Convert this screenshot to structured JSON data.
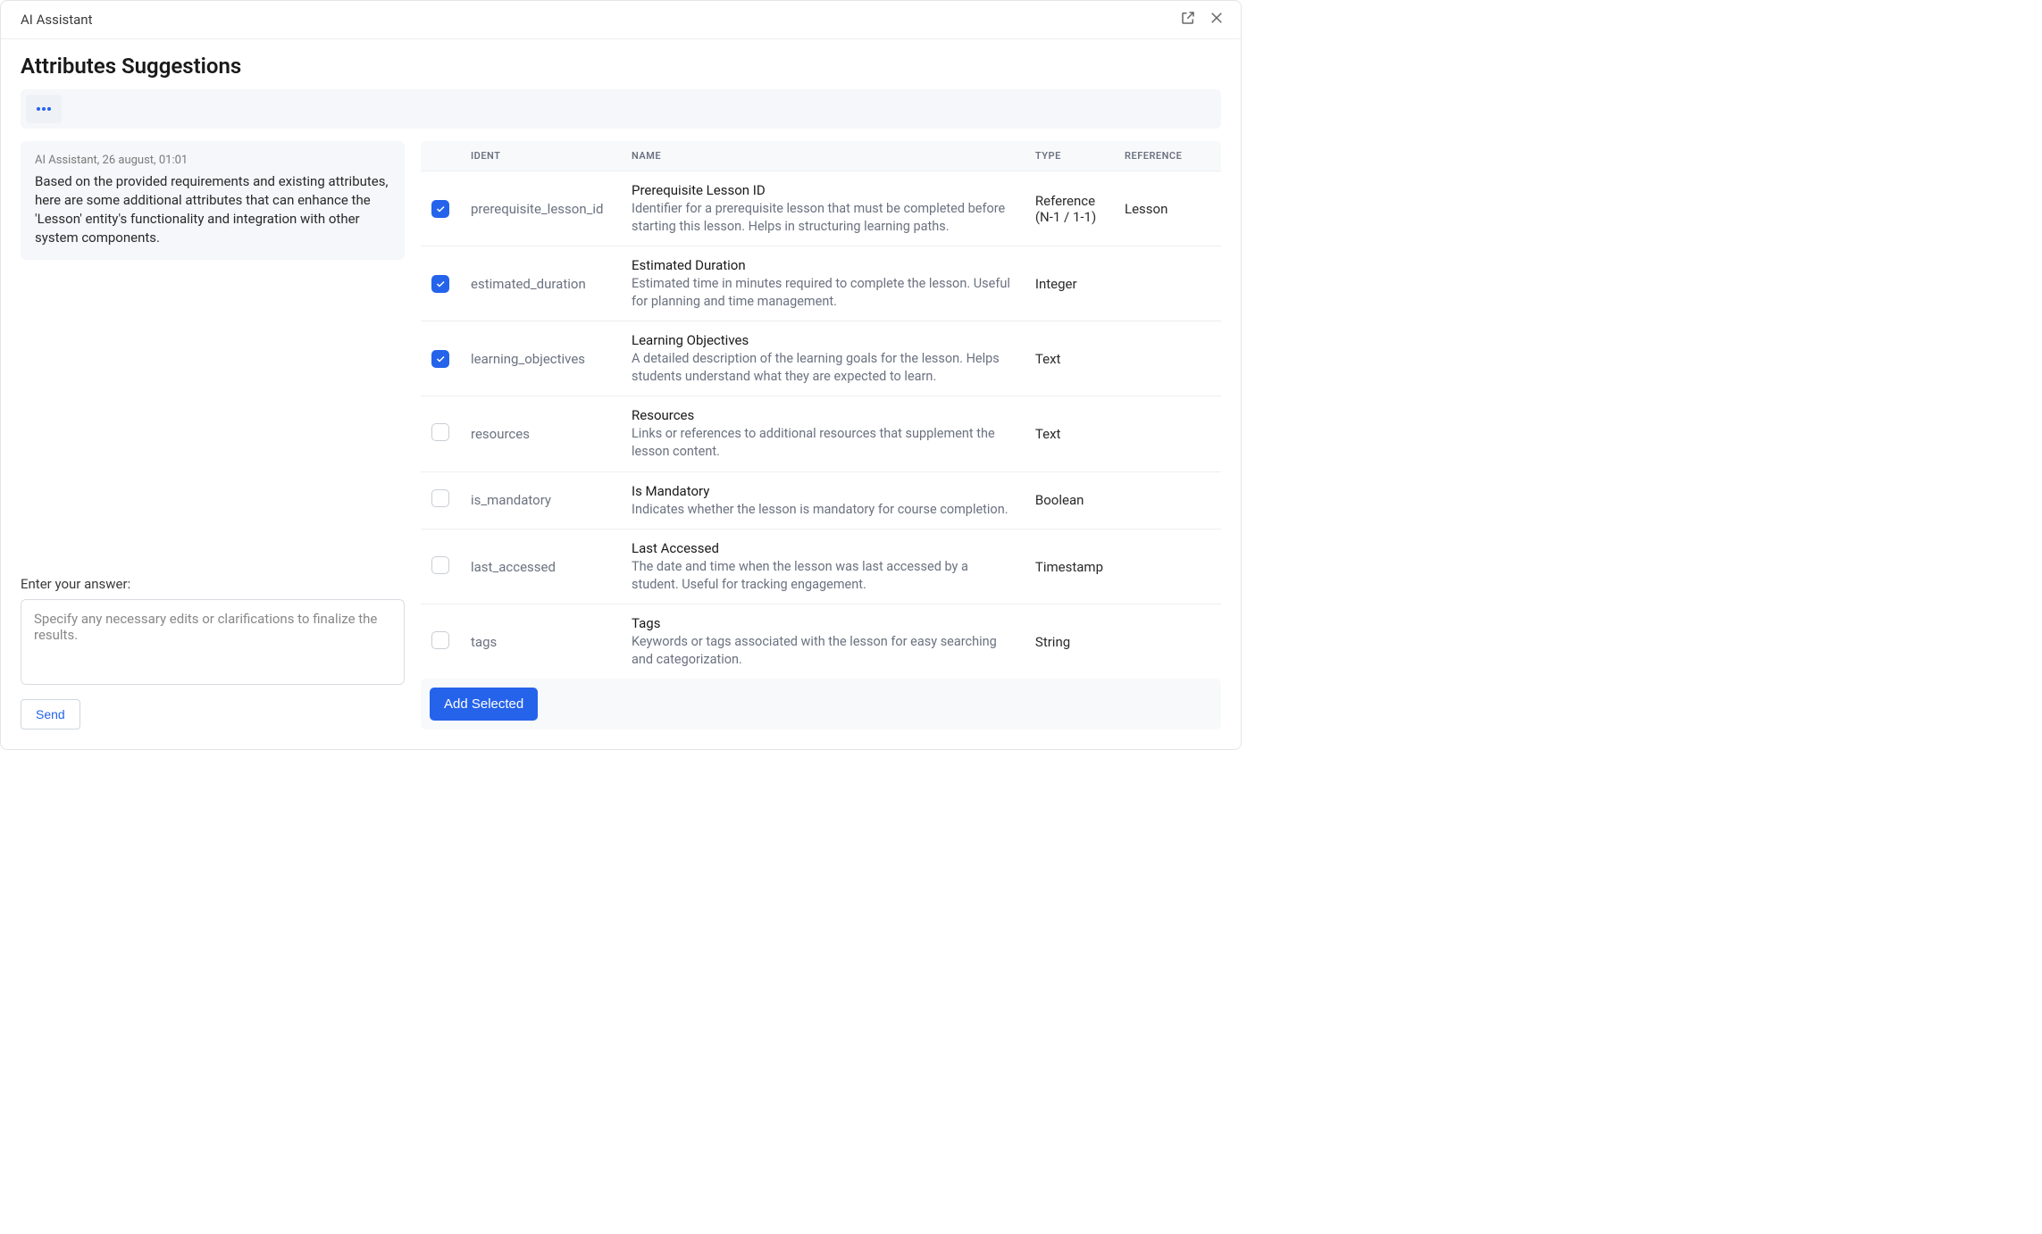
{
  "window_title": "AI Assistant",
  "page_title": "Attributes Suggestions",
  "message": {
    "meta": "AI Assistant, 26 august, 01:01",
    "body": "Based on the provided requirements and existing attributes, here are some additional attributes that can enhance the 'Lesson' entity's functionality and integration with other system components."
  },
  "answer": {
    "label": "Enter your answer:",
    "placeholder": "Specify any necessary edits or clarifications to finalize the results.",
    "send_label": "Send"
  },
  "table": {
    "headers": {
      "ident": "IDENT",
      "name": "NAME",
      "type": "TYPE",
      "reference": "REFERENCE"
    },
    "rows": [
      {
        "checked": true,
        "ident": "prerequisite_lesson_id",
        "name_title": "Prerequisite Lesson ID",
        "name_desc": "Identifier for a prerequisite lesson that must be completed before starting this lesson. Helps in structuring learning paths.",
        "type": "Reference (N-1 / 1-1)",
        "reference": "Lesson"
      },
      {
        "checked": true,
        "ident": "estimated_duration",
        "name_title": "Estimated Duration",
        "name_desc": "Estimated time in minutes required to complete the lesson. Useful for planning and time management.",
        "type": "Integer",
        "reference": ""
      },
      {
        "checked": true,
        "ident": "learning_objectives",
        "name_title": "Learning Objectives",
        "name_desc": "A detailed description of the learning goals for the lesson. Helps students understand what they are expected to learn.",
        "type": "Text",
        "reference": ""
      },
      {
        "checked": false,
        "ident": "resources",
        "name_title": "Resources",
        "name_desc": "Links or references to additional resources that supplement the lesson content.",
        "type": "Text",
        "reference": ""
      },
      {
        "checked": false,
        "ident": "is_mandatory",
        "name_title": "Is Mandatory",
        "name_desc": "Indicates whether the lesson is mandatory for course completion.",
        "type": "Boolean",
        "reference": ""
      },
      {
        "checked": false,
        "ident": "last_accessed",
        "name_title": "Last Accessed",
        "name_desc": "The date and time when the lesson was last accessed by a student. Useful for tracking engagement.",
        "type": "Timestamp",
        "reference": ""
      },
      {
        "checked": false,
        "ident": "tags",
        "name_title": "Tags",
        "name_desc": "Keywords or tags associated with the lesson for easy searching and categorization.",
        "type": "String",
        "reference": ""
      }
    ]
  },
  "actions": {
    "add_selected": "Add Selected"
  }
}
